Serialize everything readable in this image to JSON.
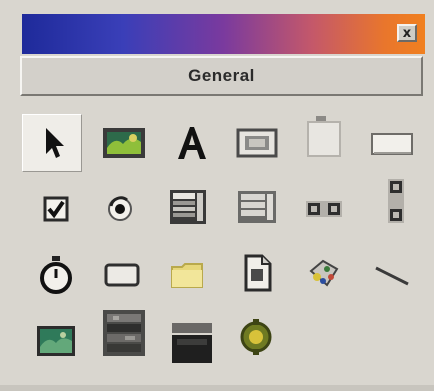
{
  "window": {
    "title": "",
    "close_glyph": "x"
  },
  "tab": {
    "label": "General"
  },
  "tools": [
    {
      "icon": "pointer-icon"
    },
    {
      "icon": "picture-icon"
    },
    {
      "icon": "label-icon"
    },
    {
      "icon": "frame-icon"
    },
    {
      "icon": "tab-strip-icon"
    },
    {
      "icon": "textbox-icon"
    },
    {
      "icon": "checkbox-icon"
    },
    {
      "icon": "option-button-icon"
    },
    {
      "icon": "combobox-icon"
    },
    {
      "icon": "listbox-icon"
    },
    {
      "icon": "hscrollbar-icon"
    },
    {
      "icon": "vscrollbar-icon"
    },
    {
      "icon": "timer-icon"
    },
    {
      "icon": "shape-icon"
    },
    {
      "icon": "dirlist-icon"
    },
    {
      "icon": "filelist-icon"
    },
    {
      "icon": "drivelist-icon"
    },
    {
      "icon": "line-icon"
    },
    {
      "icon": "image-icon"
    },
    {
      "icon": "data-icon"
    },
    {
      "icon": "ole-icon"
    },
    {
      "icon": "gear-icon"
    }
  ],
  "colors": {
    "titlebar_start": "#1e2a9a",
    "titlebar_end": "#f08020",
    "face": "#d4d0c8"
  }
}
